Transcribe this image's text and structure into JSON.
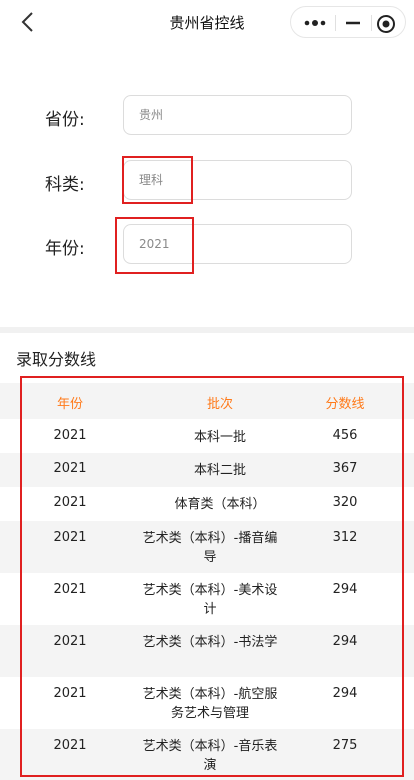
{
  "navbar": {
    "title": "贵州省控线",
    "icons": [
      "back-chevron-icon",
      "more-dots-icon",
      "minimize-icon",
      "close-circle-icon"
    ]
  },
  "form": {
    "province": {
      "label": "省份:",
      "value": "贵州"
    },
    "subject": {
      "label": "科类:",
      "value": "理科"
    },
    "year": {
      "label": "年份:",
      "value": "2021"
    }
  },
  "table_section": {
    "title": "录取分数线",
    "headers": {
      "year": "年份",
      "batch": "批次",
      "score": "分数线"
    },
    "rows": [
      {
        "year": "2021",
        "batch": "本科一批",
        "score": "456"
      },
      {
        "year": "2021",
        "batch": "本科二批",
        "score": "367"
      },
      {
        "year": "2021",
        "batch": "体育类（本科）",
        "score": "320"
      },
      {
        "year": "2021",
        "batch": "艺术类（本科）-播音编导",
        "score": "312"
      },
      {
        "year": "2021",
        "batch": "艺术类（本科）-美术设计",
        "score": "294"
      },
      {
        "year": "2021",
        "batch": "艺术类（本科）-书法学",
        "score": "294"
      },
      {
        "year": "2021",
        "batch": "艺术类（本科）-航空服务艺术与管理",
        "score": "294"
      },
      {
        "year": "2021",
        "batch": "艺术类（本科）-音乐表演",
        "score": "275"
      }
    ]
  },
  "colors": {
    "header_text": "#ff7a1a",
    "highlight": "#e02020",
    "alt_row": "#f4f4f4"
  }
}
